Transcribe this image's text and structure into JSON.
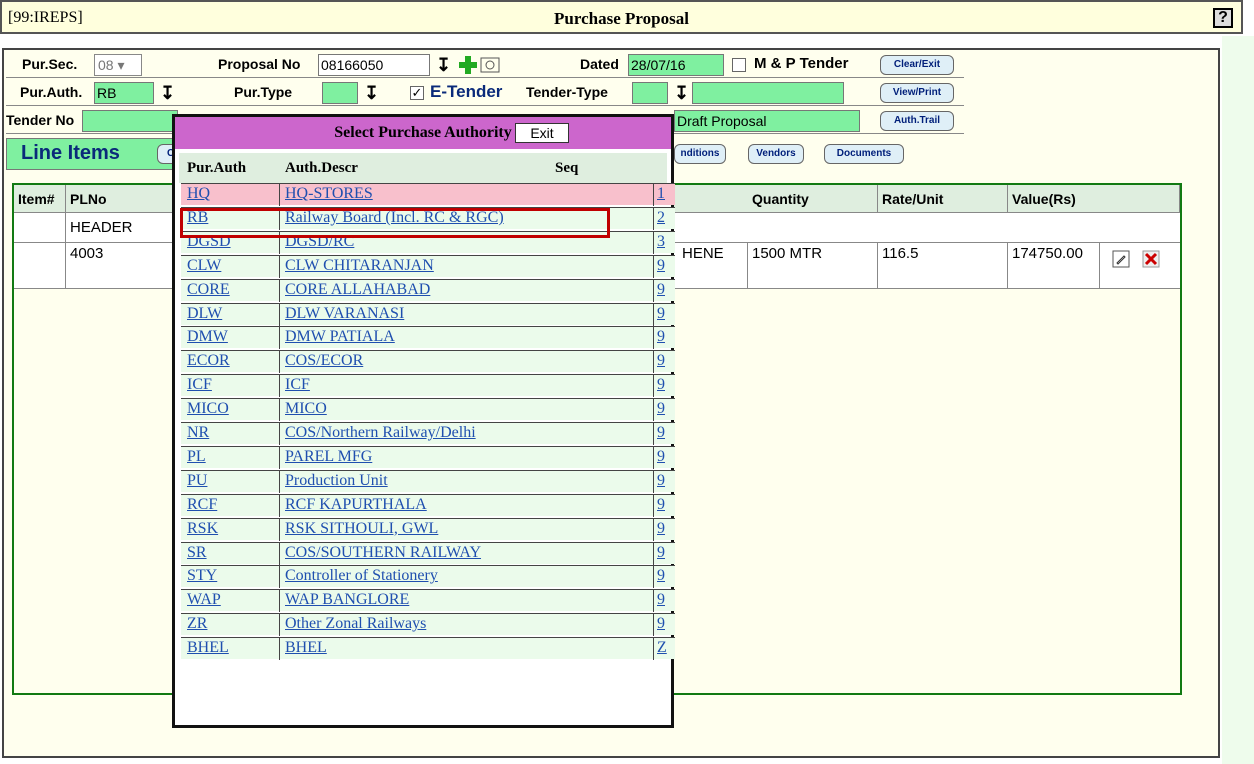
{
  "window": {
    "id": "[99:IREPS]",
    "title": "Purchase Proposal",
    "help": "?"
  },
  "form": {
    "pur_sec_label": "Pur.Sec.",
    "pur_sec_value": "08",
    "proposal_no_label": "Proposal No",
    "proposal_no_value": "08166050",
    "dated_label": "Dated",
    "dated_value": "28/07/16",
    "mp_tender_label": "M & P Tender",
    "clear_exit": "Clear/Exit",
    "pur_auth_label": "Pur.Auth.",
    "pur_auth_value": "RB",
    "pur_type_label": "Pur.Type",
    "etender_label": "E-Tender",
    "tender_type_label": "Tender-Type",
    "view_print": "View/Print",
    "tender_no_label": "Tender No",
    "draft_value": "Draft Proposal",
    "auth_trail": "Auth.Trail",
    "line_items": "Line Items",
    "line_items_btn": "Cl",
    "conditions": "nditions",
    "vendors": "Vendors",
    "documents": "Documents"
  },
  "grid": {
    "headers": [
      "Item#",
      "PLNo",
      "Quantity",
      "Rate/Unit",
      "Value(Rs)"
    ],
    "rows": [
      {
        "plno": "HEADER"
      },
      {
        "plno": "4003",
        "desc": "HENE",
        "qty": "1500 MTR",
        "rate": "116.5",
        "value": "174750.00"
      }
    ]
  },
  "popup": {
    "title": "Select Purchase Authority",
    "exit": "Exit",
    "col_auth": "Pur.Auth",
    "col_descr": "Auth.Descr",
    "col_seq": "Seq",
    "items": [
      {
        "auth": "HQ",
        "descr": "HQ-STORES",
        "seq": "1"
      },
      {
        "auth": "RB",
        "descr": "Railway Board (Incl. RC & RGC)",
        "seq": "2"
      },
      {
        "auth": "DGSD",
        "descr": "DGSD/RC",
        "seq": "3"
      },
      {
        "auth": "CLW",
        "descr": "CLW CHITARANJAN",
        "seq": "9"
      },
      {
        "auth": "CORE",
        "descr": "CORE ALLAHABAD",
        "seq": "9"
      },
      {
        "auth": "DLW",
        "descr": "DLW VARANASI",
        "seq": "9"
      },
      {
        "auth": "DMW",
        "descr": "DMW PATIALA",
        "seq": "9"
      },
      {
        "auth": "ECOR",
        "descr": "COS/ECOR",
        "seq": "9"
      },
      {
        "auth": "ICF",
        "descr": "ICF",
        "seq": "9"
      },
      {
        "auth": "MICO",
        "descr": "MICO",
        "seq": "9"
      },
      {
        "auth": "NR",
        "descr": "COS/Northern Railway/Delhi",
        "seq": "9"
      },
      {
        "auth": "PL",
        "descr": "PAREL MFG",
        "seq": "9"
      },
      {
        "auth": "PU",
        "descr": "Production Unit",
        "seq": "9"
      },
      {
        "auth": "RCF",
        "descr": "RCF KAPURTHALA",
        "seq": "9"
      },
      {
        "auth": "RSK",
        "descr": "RSK SITHOULI, GWL",
        "seq": "9"
      },
      {
        "auth": "SR",
        "descr": "COS/SOUTHERN RAILWAY",
        "seq": "9"
      },
      {
        "auth": "STY",
        "descr": "Controller of Stationery",
        "seq": "9"
      },
      {
        "auth": "WAP",
        "descr": "WAP BANGLORE",
        "seq": "9"
      },
      {
        "auth": "ZR",
        "descr": "Other Zonal Railways",
        "seq": "9"
      },
      {
        "auth": "BHEL",
        "descr": "BHEL",
        "seq": "Z"
      }
    ]
  }
}
